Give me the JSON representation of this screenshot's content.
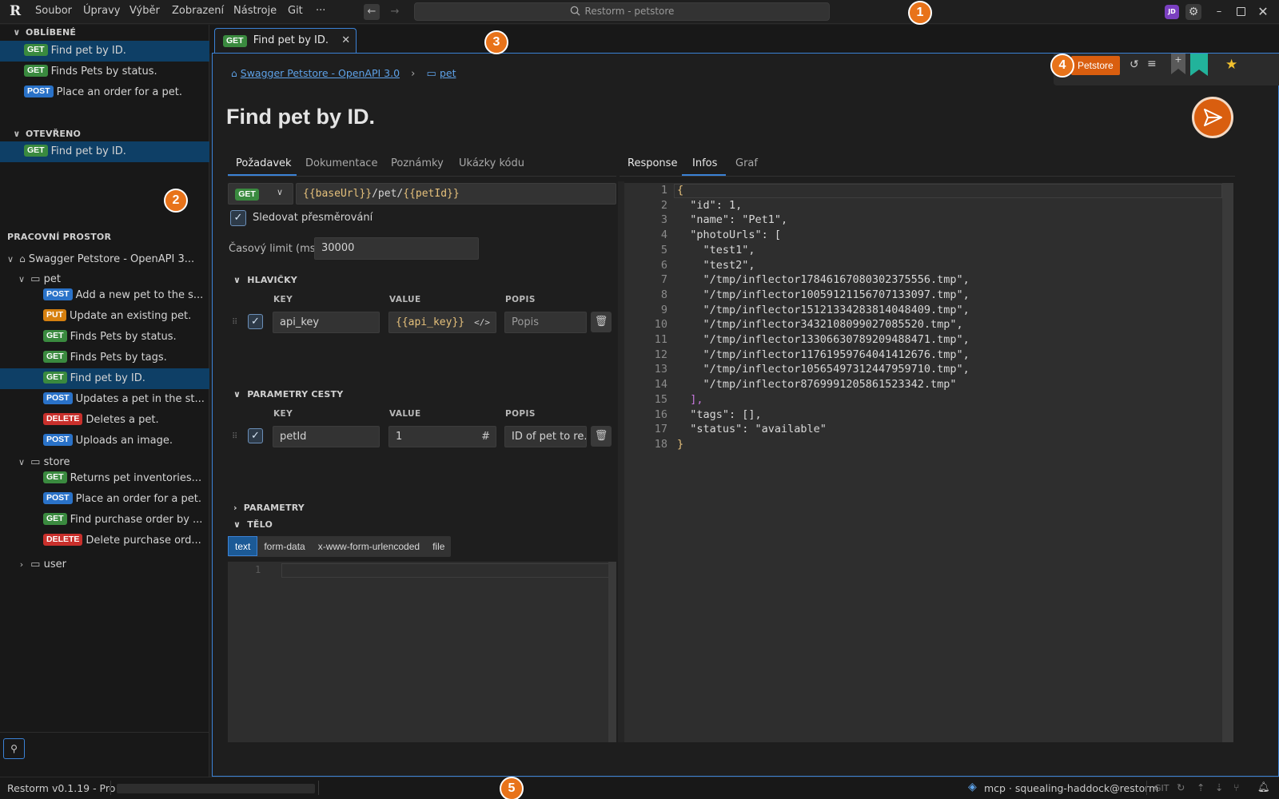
{
  "titlebar": {
    "logo": "R",
    "menu": [
      "Soubor",
      "Úpravy",
      "Výběr",
      "Zobrazení",
      "Nástroje",
      "Git",
      "···"
    ],
    "search": "Restorm - petstore",
    "avatar": "JD"
  },
  "sidebar": {
    "favorites_title": "OBLÍBENÉ",
    "favorites": [
      {
        "method": "GET",
        "label": "Find pet by ID."
      },
      {
        "method": "GET",
        "label": "Finds Pets by status."
      },
      {
        "method": "POST",
        "label": "Place an order for a pet."
      }
    ],
    "open_title": "OTEVŘENO",
    "open": [
      {
        "method": "GET",
        "label": "Find pet by ID."
      }
    ],
    "workspace_title": "PRACOVNÍ PROSTOR",
    "collection": "Swagger Petstore - OpenAPI 3...",
    "folders": {
      "pet": "pet",
      "store": "store",
      "user": "user"
    },
    "pet_items": [
      {
        "method": "POST",
        "label": "Add a new pet to the s..."
      },
      {
        "method": "PUT",
        "label": "Update an existing pet."
      },
      {
        "method": "GET",
        "label": "Finds Pets by status."
      },
      {
        "method": "GET",
        "label": "Finds Pets by tags."
      },
      {
        "method": "GET",
        "label": "Find pet by ID."
      },
      {
        "method": "POST",
        "label": "Updates a pet in the st..."
      },
      {
        "method": "DELETE",
        "label": "Deletes a pet."
      },
      {
        "method": "POST",
        "label": "Uploads an image."
      }
    ],
    "store_items": [
      {
        "method": "GET",
        "label": "Returns pet inventories..."
      },
      {
        "method": "POST",
        "label": "Place an order for a pet."
      },
      {
        "method": "GET",
        "label": "Find purchase order by ..."
      },
      {
        "method": "DELETE",
        "label": "Delete purchase ord..."
      }
    ]
  },
  "tab": {
    "method": "GET",
    "label": "Find pet by ID."
  },
  "breadcrumb": {
    "collection": "Swagger Petstore - OpenAPI 3.0",
    "folder": "pet"
  },
  "toolbar": {
    "environment": "Petstore"
  },
  "title": "Find pet by ID.",
  "request": {
    "tabs": [
      "Požadavek",
      "Dokumentace",
      "Poznámky",
      "Ukázky kódu"
    ],
    "method": "GET",
    "url_parts": [
      "{{",
      "baseUrl",
      "}}",
      "/pet/",
      "{{",
      "petId",
      "}}"
    ],
    "follow_redirects": "Sledovat přesměrování",
    "timeout_label": "Časový limit (ms)",
    "timeout_value": "30000",
    "headers_title": "HLAVIČKY",
    "path_params_title": "PARAMETRY CESTY",
    "params_title": "PARAMETRY",
    "body_title": "TĚLO",
    "columns": [
      "KEY",
      "VALUE",
      "POPIS"
    ],
    "header_row": {
      "key": "api_key",
      "value_parts": [
        "{{",
        "api_key",
        "}}"
      ],
      "desc_placeholder": "Popis"
    },
    "path_row": {
      "key": "petId",
      "value": "1",
      "desc": "ID of pet to re..."
    },
    "body_modes": [
      "text",
      "form-data",
      "x-www-form-urlencoded",
      "file"
    ],
    "body_line": "1"
  },
  "response": {
    "tabs": [
      "Response",
      "Infos",
      "Graf"
    ],
    "lines": [
      "{",
      "  \"id\": 1,",
      "  \"name\": \"Pet1\",",
      "  \"photoUrls\": [",
      "    \"test1\",",
      "    \"test2\",",
      "    \"/tmp/inflector17846167080302375556.tmp\",",
      "    \"/tmp/inflector10059121156707133097.tmp\",",
      "    \"/tmp/inflector15121334283814048409.tmp\",",
      "    \"/tmp/inflector3432108099027085520.tmp\",",
      "    \"/tmp/inflector13306630789209488471.tmp\",",
      "    \"/tmp/inflector11761959764041412676.tmp\",",
      "    \"/tmp/inflector10565497312447959710.tmp\",",
      "    \"/tmp/inflector8769991205861523342.tmp\"",
      "  ],",
      "  \"tags\": [],",
      "  \"status\": \"available\"",
      "}"
    ]
  },
  "statusbar": {
    "version": "Restorm v0.1.19 - Pro",
    "mcp": "mcp · squealing-haddock@restorm",
    "git": "GIT"
  },
  "callouts": [
    "1",
    "2",
    "3",
    "4",
    "5"
  ],
  "colors": {
    "accent": "#3b82d6",
    "send": "#d95e0f",
    "get": "#3a8a3f",
    "post": "#2a72c8",
    "put": "#d6800f",
    "delete": "#c9302c",
    "selection": "#0e3f66",
    "template": "#e5c07b"
  }
}
